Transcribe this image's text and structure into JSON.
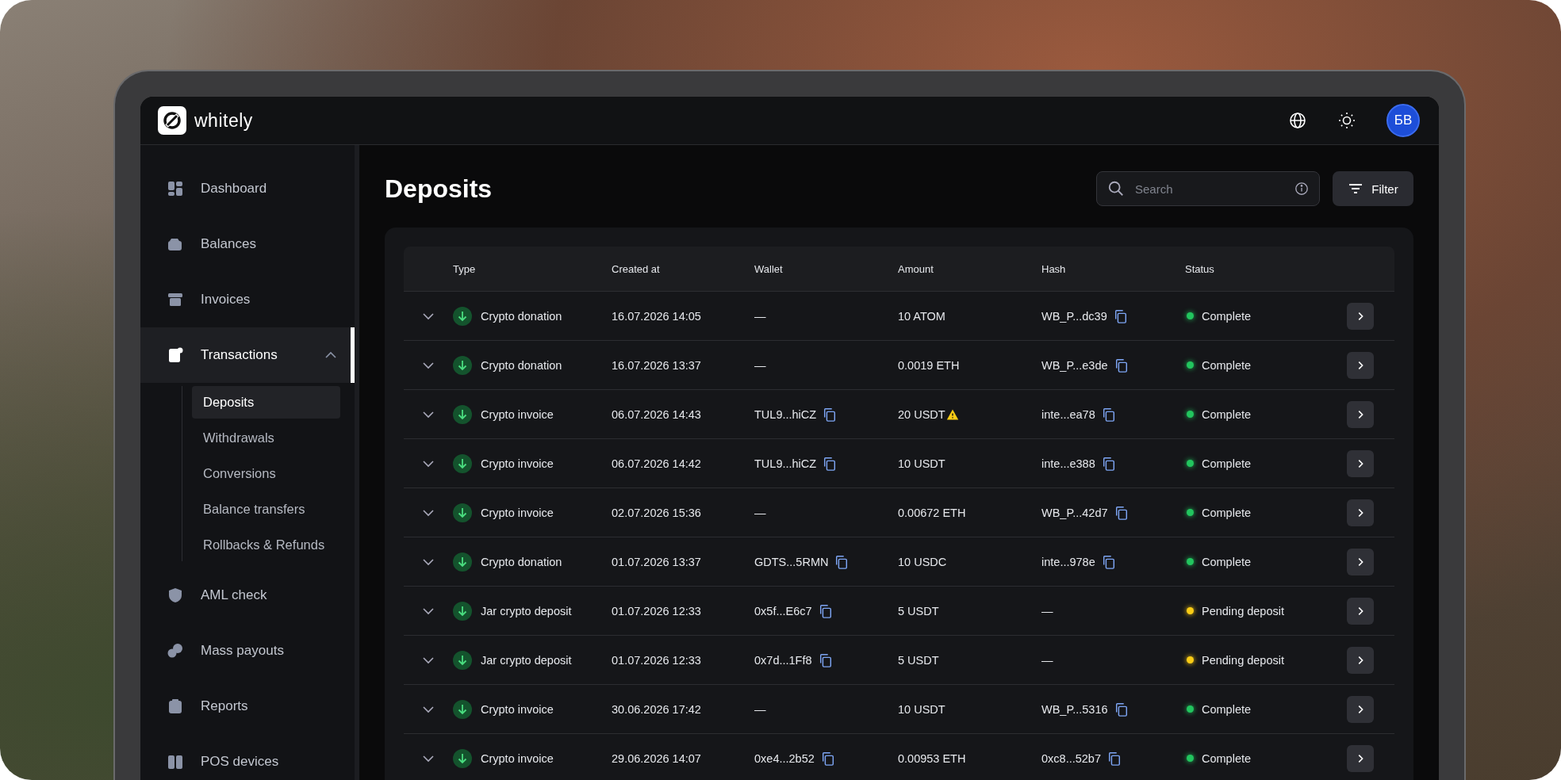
{
  "brand": {
    "name": "whitely"
  },
  "header": {
    "avatar": "БВ"
  },
  "sidebar": {
    "items": [
      {
        "label": "Dashboard",
        "selected": false
      },
      {
        "label": "Balances",
        "selected": false
      },
      {
        "label": "Invoices",
        "selected": false
      },
      {
        "label": "Transactions",
        "selected": true,
        "expanded": true,
        "children": [
          {
            "label": "Deposits",
            "selected": true
          },
          {
            "label": "Withdrawals",
            "selected": false
          },
          {
            "label": "Conversions",
            "selected": false
          },
          {
            "label": "Balance transfers",
            "selected": false
          },
          {
            "label": "Rollbacks & Refunds",
            "selected": false
          }
        ]
      },
      {
        "label": "AML check",
        "selected": false
      },
      {
        "label": "Mass payouts",
        "selected": false
      },
      {
        "label": "Reports",
        "selected": false
      },
      {
        "label": "POS devices",
        "selected": false
      }
    ]
  },
  "page": {
    "title": "Deposits",
    "search": {
      "placeholder": "Search"
    },
    "filter_button": "Filter"
  },
  "table": {
    "columns": [
      "Type",
      "Created at",
      "Wallet",
      "Amount",
      "Hash",
      "Status"
    ],
    "rows": [
      {
        "type": "Crypto donation",
        "created": "16.07.2026 14:05",
        "wallet": "—",
        "wallet_copy": false,
        "amount": "10 ATOM",
        "warning": false,
        "hash": "WB_P...dc39",
        "hash_copy": true,
        "status": "Complete",
        "color": "#22c55e"
      },
      {
        "type": "Crypto donation",
        "created": "16.07.2026 13:37",
        "wallet": "—",
        "wallet_copy": false,
        "amount": "0.0019 ETH",
        "warning": false,
        "hash": "WB_P...e3de",
        "hash_copy": true,
        "status": "Complete",
        "color": "#22c55e"
      },
      {
        "type": "Crypto invoice",
        "created": "06.07.2026 14:43",
        "wallet": "TUL9...hiCZ",
        "wallet_copy": true,
        "amount": "20 USDT",
        "warning": true,
        "hash": "inte...ea78",
        "hash_copy": true,
        "status": "Complete",
        "color": "#22c55e"
      },
      {
        "type": "Crypto invoice",
        "created": "06.07.2026 14:42",
        "wallet": "TUL9...hiCZ",
        "wallet_copy": true,
        "amount": "10 USDT",
        "warning": false,
        "hash": "inte...e388",
        "hash_copy": true,
        "status": "Complete",
        "color": "#22c55e"
      },
      {
        "type": "Crypto invoice",
        "created": "02.07.2026 15:36",
        "wallet": "—",
        "wallet_copy": false,
        "amount": "0.00672 ETH",
        "warning": false,
        "hash": "WB_P...42d7",
        "hash_copy": true,
        "status": "Complete",
        "color": "#22c55e"
      },
      {
        "type": "Crypto donation",
        "created": "01.07.2026 13:37",
        "wallet": "GDTS...5RMN",
        "wallet_copy": true,
        "amount": "10 USDC",
        "warning": false,
        "hash": "inte...978e",
        "hash_copy": true,
        "status": "Complete",
        "color": "#22c55e"
      },
      {
        "type": "Jar crypto deposit",
        "created": "01.07.2026 12:33",
        "wallet": "0x5f...E6c7",
        "wallet_copy": true,
        "amount": "5 USDT",
        "warning": false,
        "hash": "—",
        "hash_copy": false,
        "status": "Pending deposit",
        "color": "#facc15"
      },
      {
        "type": "Jar crypto deposit",
        "created": "01.07.2026 12:33",
        "wallet": "0x7d...1Ff8",
        "wallet_copy": true,
        "amount": "5 USDT",
        "warning": false,
        "hash": "—",
        "hash_copy": false,
        "status": "Pending deposit",
        "color": "#facc15"
      },
      {
        "type": "Crypto invoice",
        "created": "30.06.2026 17:42",
        "wallet": "—",
        "wallet_copy": false,
        "amount": "10 USDT",
        "warning": false,
        "hash": "WB_P...5316",
        "hash_copy": true,
        "status": "Complete",
        "color": "#22c55e"
      },
      {
        "type": "Crypto invoice",
        "created": "29.06.2026 14:07",
        "wallet": "0xe4...2b52",
        "wallet_copy": true,
        "amount": "0.00953 ETH",
        "warning": false,
        "hash": "0xc8...52b7",
        "hash_copy": true,
        "status": "Complete",
        "color": "#22c55e"
      }
    ]
  }
}
